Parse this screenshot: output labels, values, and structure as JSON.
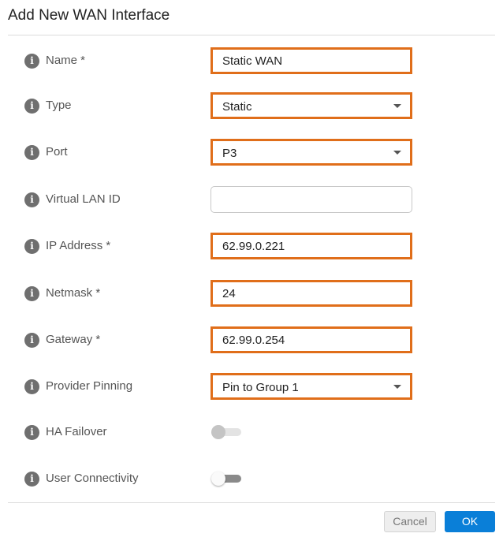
{
  "dialog": {
    "title": "Add New WAN Interface"
  },
  "fields": {
    "name": {
      "label": "Name *",
      "value": "Static WAN"
    },
    "type": {
      "label": "Type",
      "value": "Static"
    },
    "port": {
      "label": "Port",
      "value": "P3"
    },
    "vlan": {
      "label": "Virtual LAN ID",
      "value": ""
    },
    "ip": {
      "label": "IP Address *",
      "value": "62.99.0.221"
    },
    "netmask": {
      "label": "Netmask *",
      "value": "24"
    },
    "gateway": {
      "label": "Gateway *",
      "value": "62.99.0.254"
    },
    "pinning": {
      "label": "Provider Pinning",
      "value": "Pin to Group 1"
    },
    "ha_failover": {
      "label": "HA Failover",
      "state": "off-disabled"
    },
    "user_connectivity": {
      "label": "User Connectivity",
      "state": "off"
    }
  },
  "info_glyph": "i",
  "buttons": {
    "cancel": "Cancel",
    "ok": "OK"
  },
  "colors": {
    "highlight_border": "#e06e1a",
    "ok_button": "#0a7fd8",
    "info_icon": "#6f6f6f"
  }
}
